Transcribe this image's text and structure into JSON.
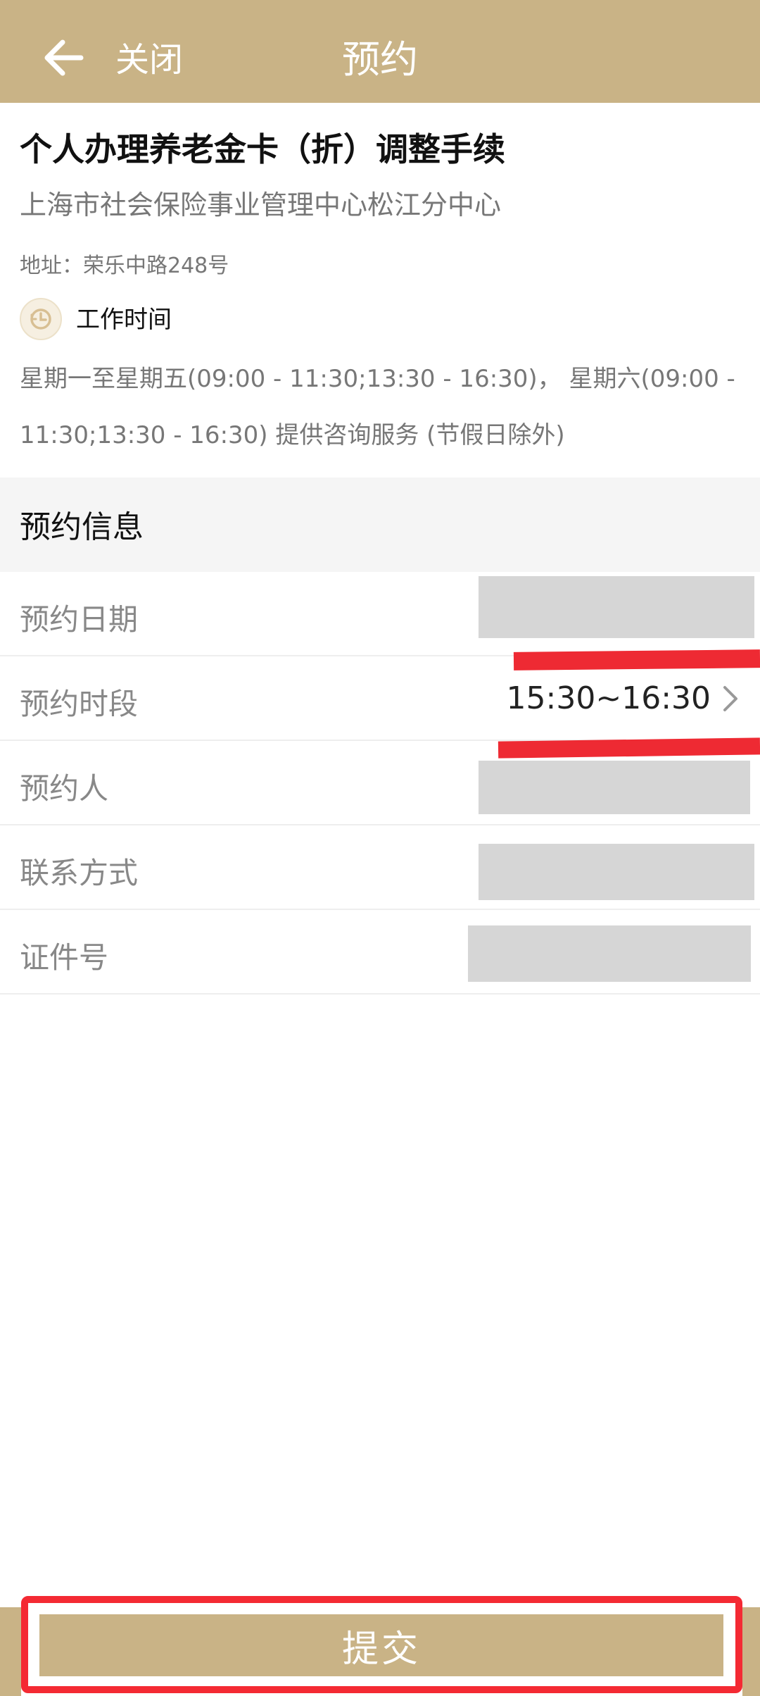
{
  "header": {
    "back_icon": "arrow-left-icon",
    "close_label": "关闭",
    "title": "预约"
  },
  "service": {
    "title": "个人办理养老金卡（折）调整手续",
    "org": "上海市社会保险事业管理中心松江分中心",
    "address": "地址：荣乐中路248号",
    "hours_icon": "clock-icon",
    "hours_label": "工作时间",
    "hours_text": "星期一至星期五(09:00 - 11:30;13:30 - 16:30)， 星期六(09:00 - 11:30;13:30 - 16:30) 提供咨询服务 (节假日除外)"
  },
  "form": {
    "section_title": "预约信息",
    "rows": [
      {
        "label": "预约日期",
        "value": ""
      },
      {
        "label": "预约时段",
        "value": "15:30~16:30",
        "chevron_icon": "chevron-right-icon"
      },
      {
        "label": "预约人",
        "value": ""
      },
      {
        "label": "联系方式",
        "value": ""
      },
      {
        "label": "证件号",
        "value": ""
      }
    ]
  },
  "submit": {
    "label": "提交"
  },
  "colors": {
    "brand": "#c9b386",
    "highlight": "#f42a33",
    "redaction": "#d6d6d6"
  }
}
